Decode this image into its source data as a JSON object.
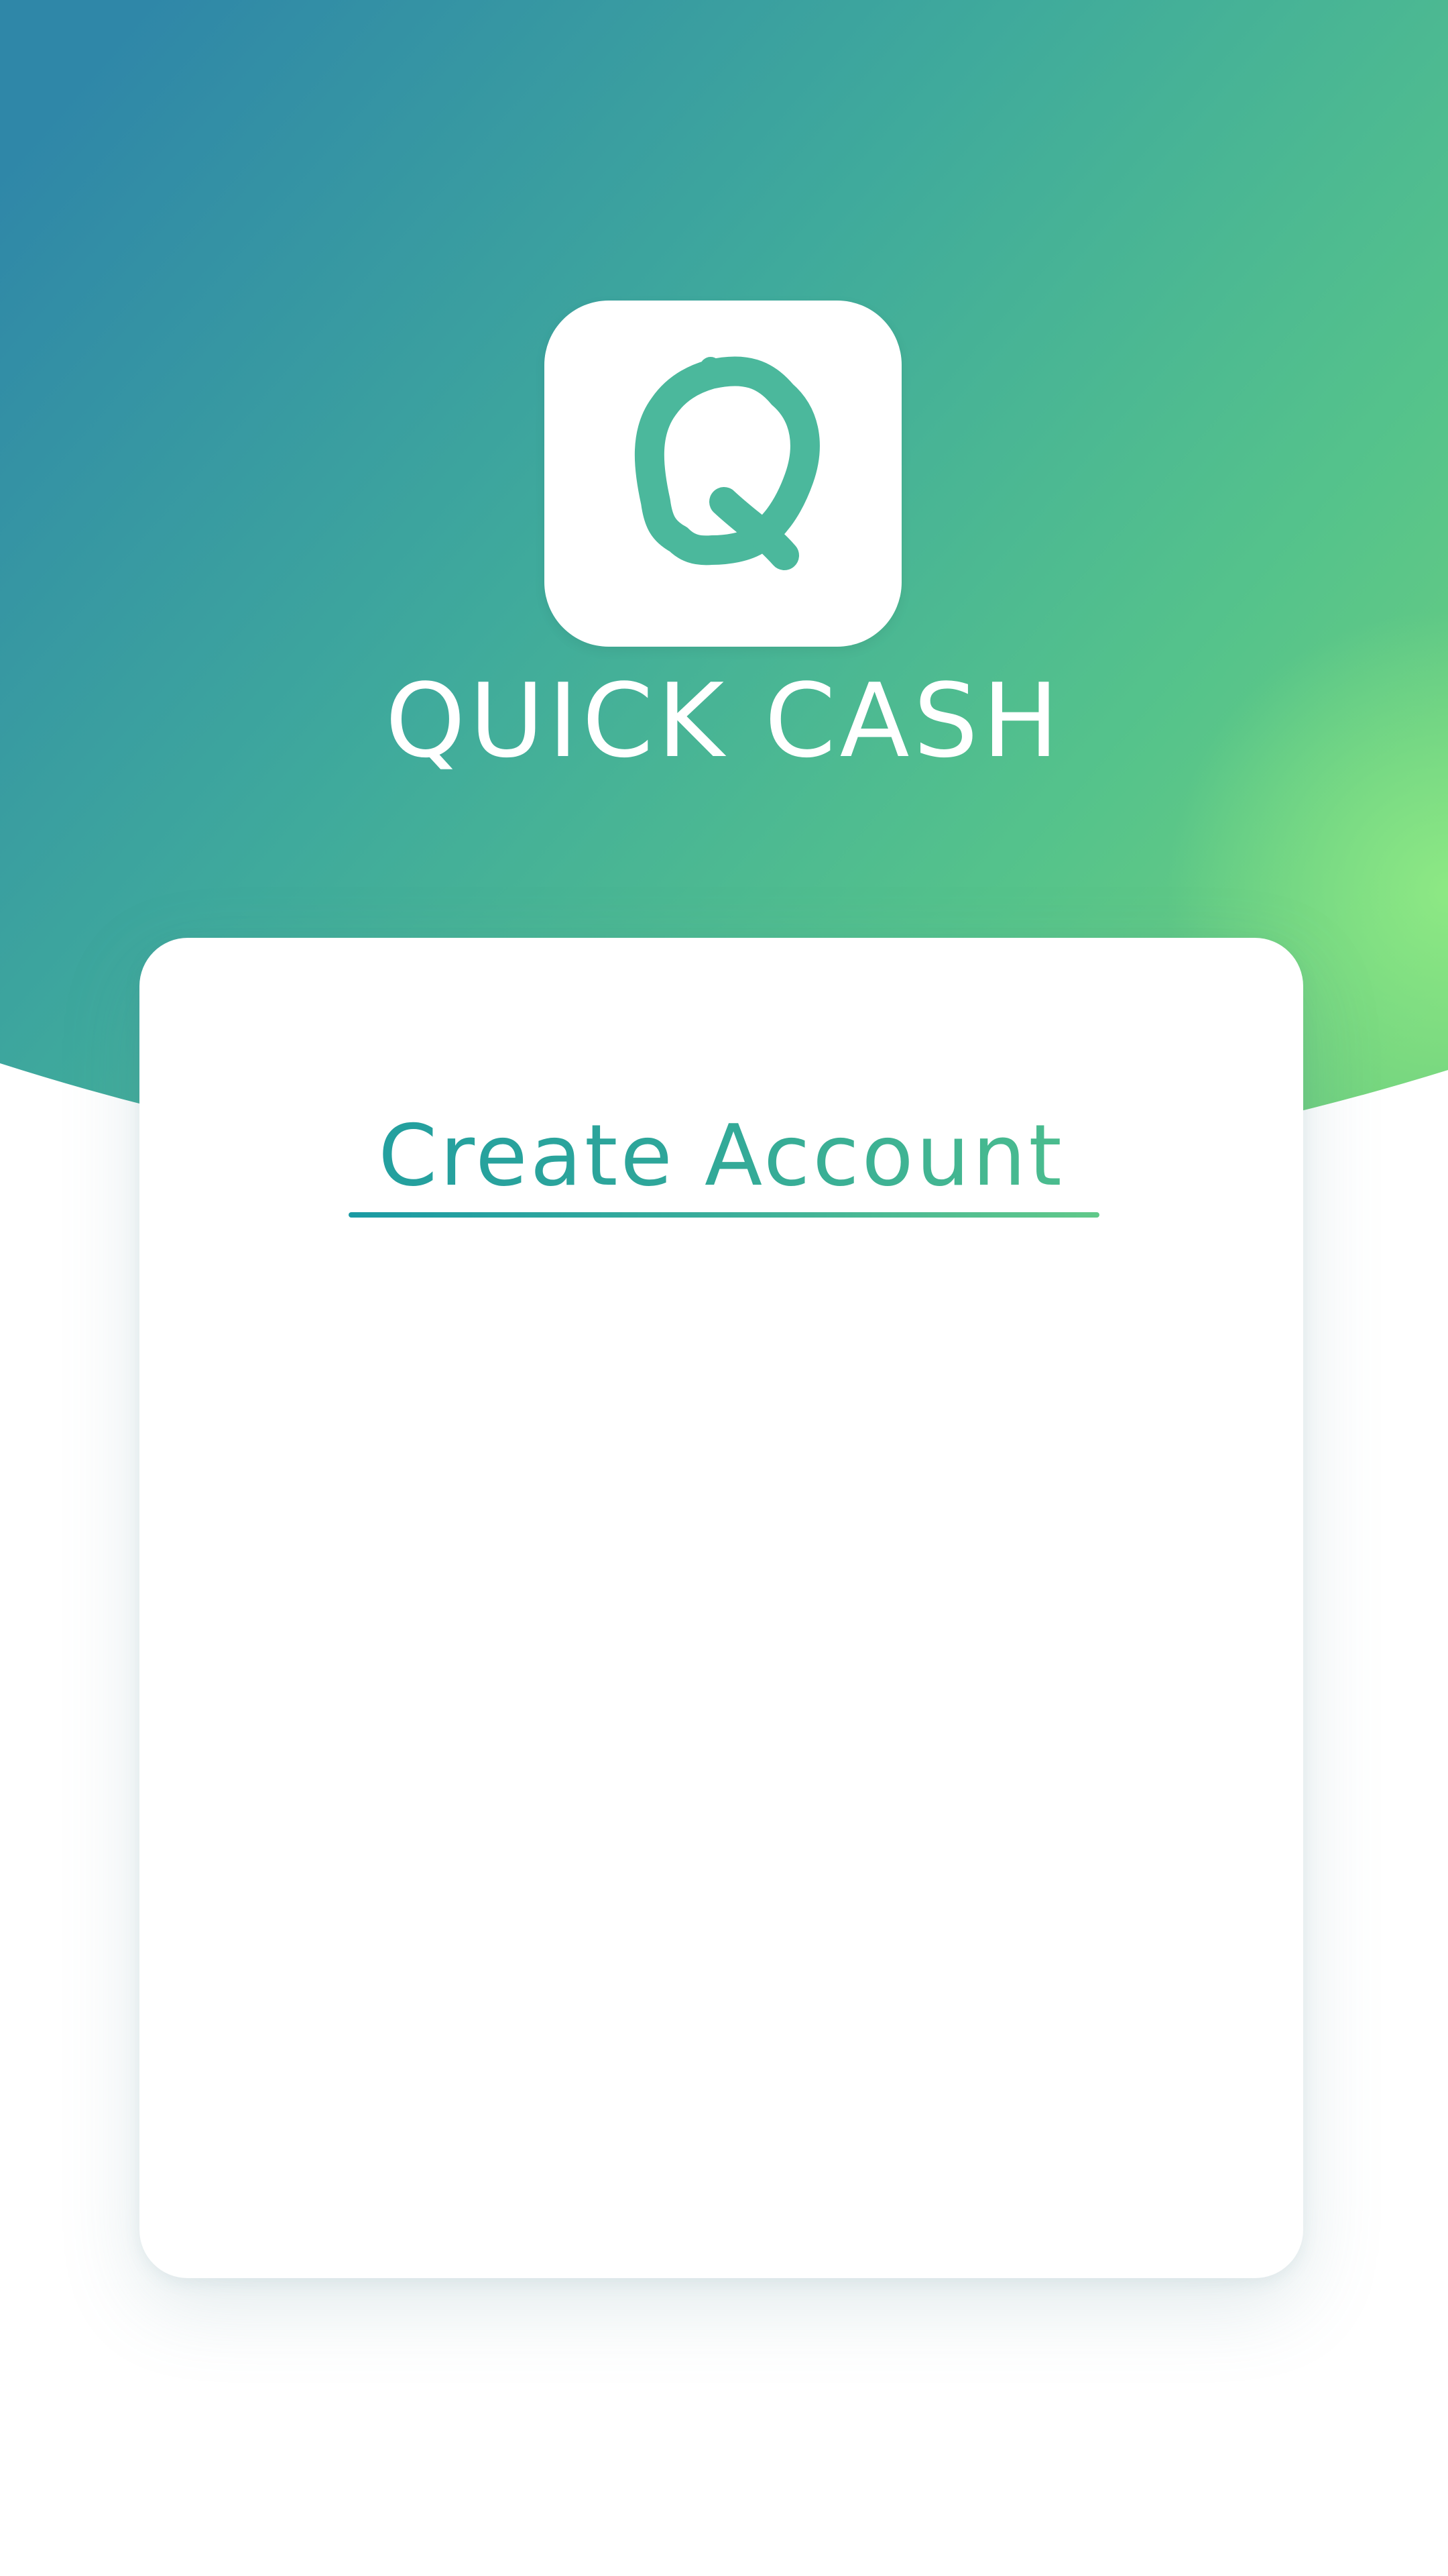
{
  "app": {
    "name": "QUICK CASH",
    "logo_letter": "Q"
  },
  "icons": {
    "logo": "q-letter-logo-icon"
  },
  "colors": {
    "gradient_start": "#2f89a6",
    "gradient_mid": "#49b995",
    "gradient_end": "#7fdd7a",
    "accent": "#22a59b",
    "card_background": "#ffffff"
  },
  "form": {
    "title": "Create Account"
  }
}
